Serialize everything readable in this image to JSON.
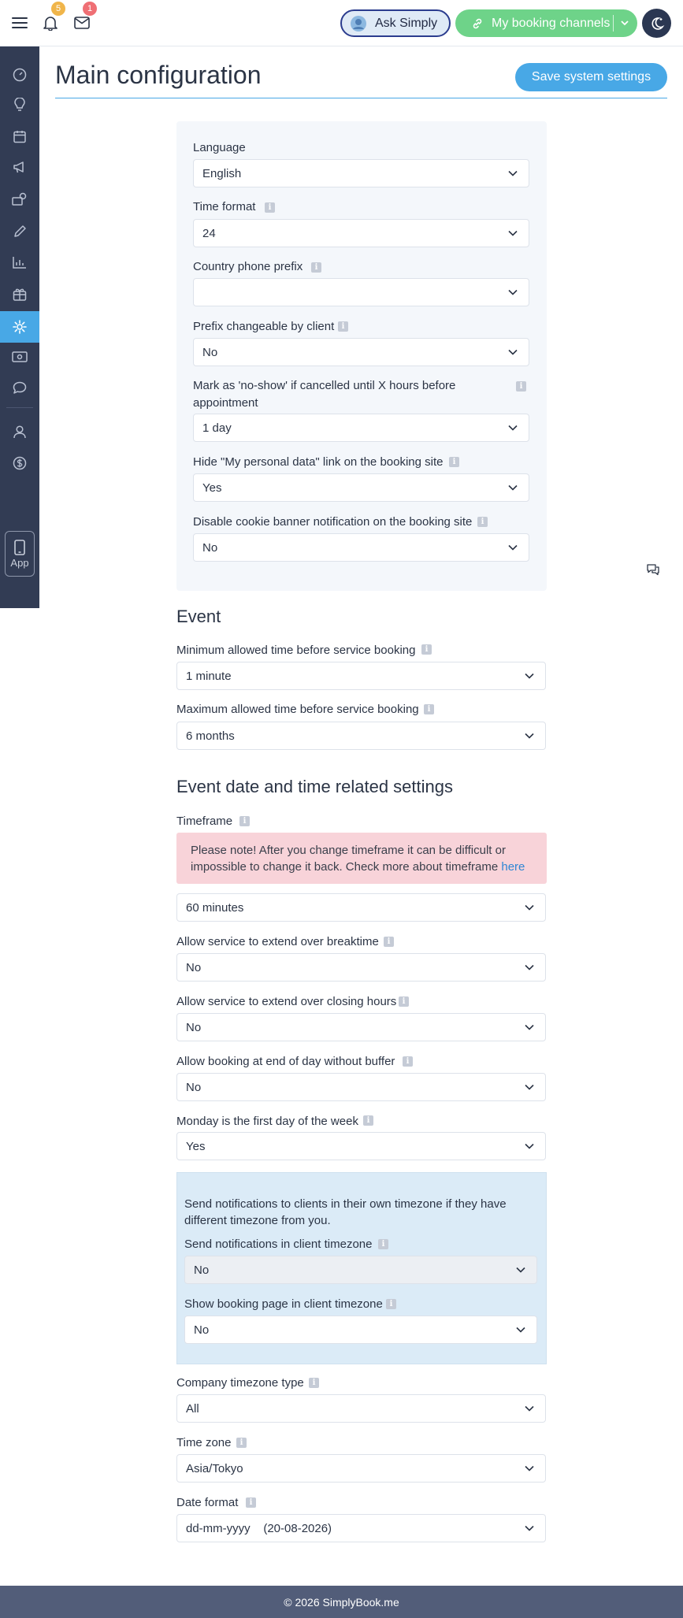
{
  "topbar": {
    "notifications_count": "5",
    "messages_count": "1",
    "ask_label": "Ask Simply",
    "channels_label": "My booking channels"
  },
  "sidebar": {
    "items": [
      "dashboard-icon",
      "bulb-icon",
      "calendar-icon",
      "megaphone-icon",
      "users-icon",
      "pencil-icon",
      "chart-icon",
      "gift-icon",
      "gear-icon",
      "money-icon",
      "chat-icon",
      "person-icon",
      "dollar-icon"
    ],
    "active": "gear-icon",
    "app_label": "App"
  },
  "header": {
    "title": "Main configuration",
    "save_label": "Save system settings"
  },
  "general": {
    "language": {
      "label": "Language",
      "value": "English"
    },
    "time_format": {
      "label": "Time format",
      "value": "24"
    },
    "phone_prefix": {
      "label": "Country phone prefix",
      "value": ""
    },
    "prefix_changeable": {
      "label": "Prefix changeable by client",
      "value": "No"
    },
    "no_show": {
      "label_line1": "Mark as 'no-show' if cancelled until X hours before",
      "label_line2": "appointment",
      "value": "1 day"
    },
    "hide_personal": {
      "label": "Hide \"My personal data\" link on the booking site",
      "value": "Yes"
    },
    "disable_cookie": {
      "label": "Disable cookie banner notification on the booking site",
      "value": "No"
    }
  },
  "event": {
    "title": "Event",
    "min_time": {
      "label": "Minimum allowed time before service booking",
      "value": "1 minute"
    },
    "max_time": {
      "label": "Maximum allowed time before service booking",
      "value": "6 months"
    }
  },
  "datetime": {
    "title": "Event date and time related settings",
    "timeframe": {
      "label": "Timeframe",
      "value": "60 minutes"
    },
    "warning_line1": "Please note! After you change timeframe it can be difficult or",
    "warning_line2": "impossible to change it back. Check more about timeframe",
    "warning_link": "here",
    "breaktime": {
      "label": "Allow service to extend over breaktime",
      "value": "No"
    },
    "closing_hours": {
      "label": "Allow service to extend over closing hours",
      "value": "No"
    },
    "end_of_day": {
      "label": "Allow booking at end of day without buffer",
      "value": "No"
    },
    "monday_first": {
      "label": "Monday is the first day of the week",
      "value": "Yes"
    },
    "tz_note_line1": "Send notifications to clients in their own timezone if they have",
    "tz_note_line2": "different timezone from you.",
    "client_tz_notif": {
      "label": "Send notifications in client timezone",
      "value": "No"
    },
    "client_tz_page": {
      "label": "Show booking page in client timezone",
      "value": "No"
    },
    "company_tz_type": {
      "label": "Company timezone type",
      "value": "All"
    },
    "timezone": {
      "label": "Time zone",
      "value": "Asia/Tokyo"
    },
    "date_format": {
      "label": "Date format",
      "value": "dd-mm-yyyy    (20-08-2026)"
    }
  },
  "footer": {
    "text": "© 2026 SimplyBook.me"
  },
  "colors": {
    "accent": "#48a8e6",
    "sidebar": "#323c54",
    "green": "#6ed389",
    "warning_bg": "#f8d3d9",
    "info_bg": "#dbebf7"
  }
}
